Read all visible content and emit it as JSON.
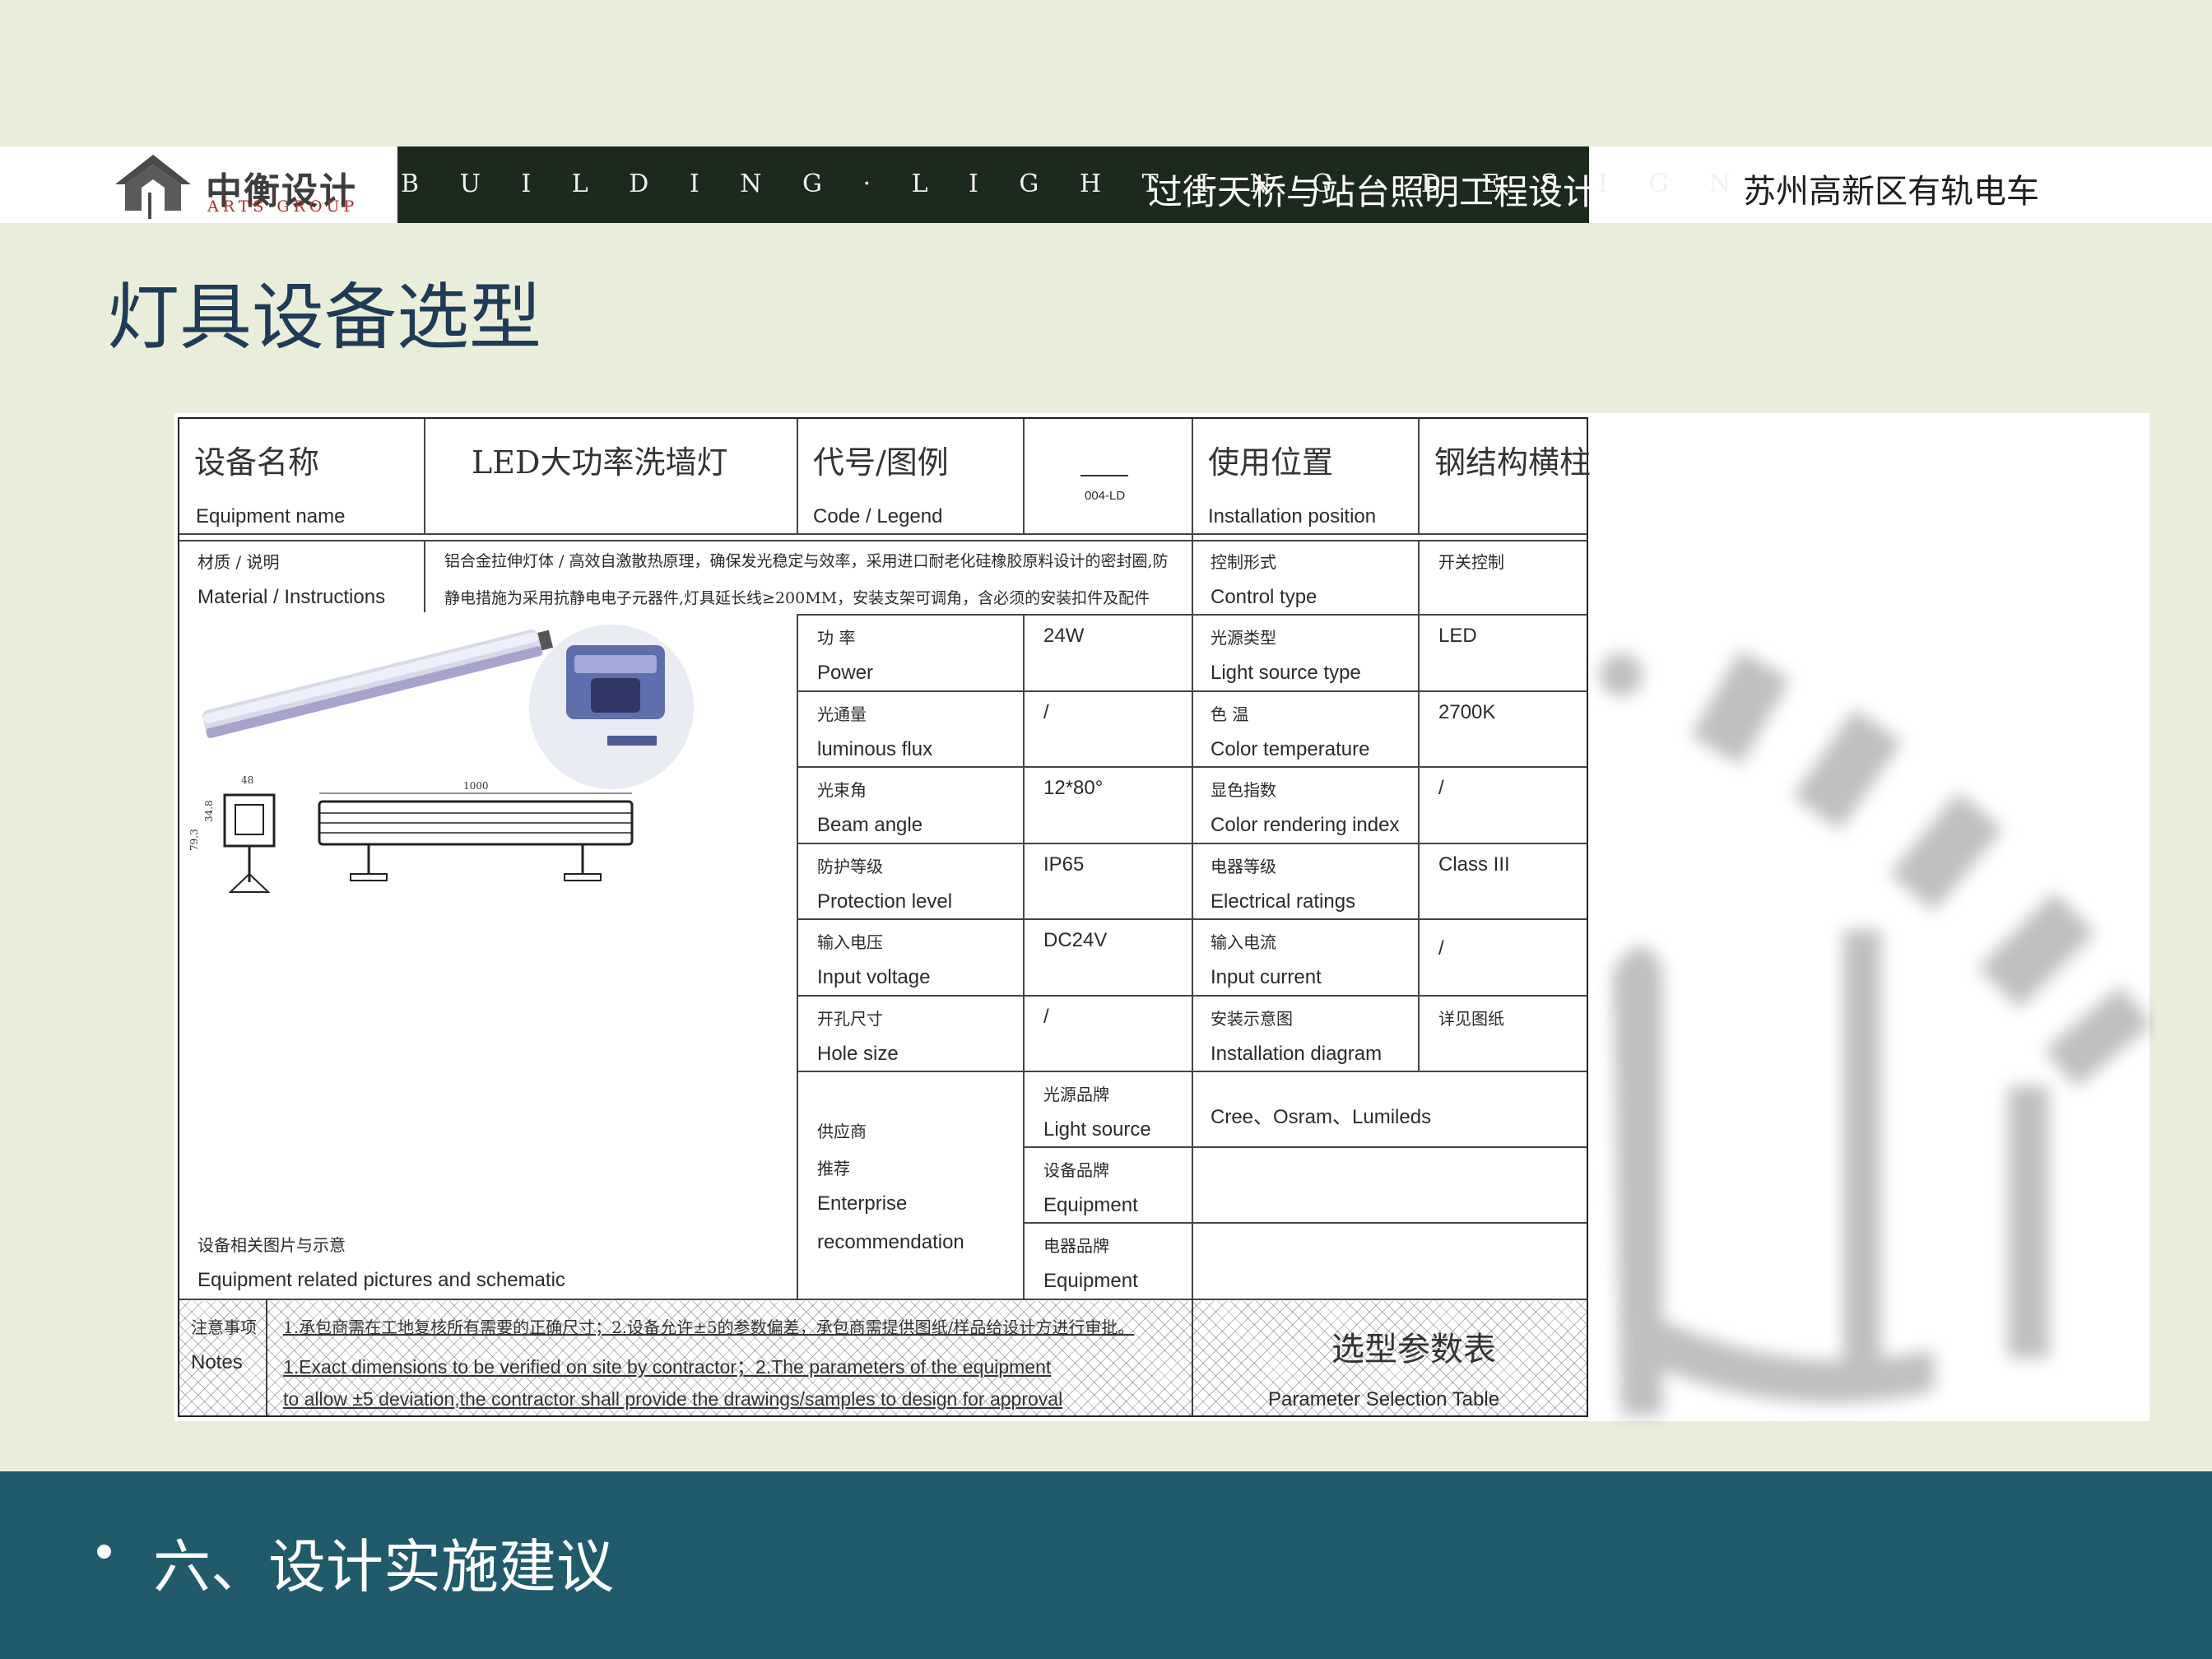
{
  "header": {
    "logo_cn": "中衡设计",
    "logo_en": "ARTS GROUP",
    "banner_en": "B U I L D I N G · L I G H T I N G · D E S I G N",
    "banner_cn": "过街天桥与站台照明工程设计",
    "project": "苏州高新区有轨电车"
  },
  "page_title": "灯具设备选型",
  "spec": {
    "equipment_name_cn": "设备名称",
    "equipment_name_en": "Equipment name",
    "equipment_name_value": "LED大功率洗墙灯",
    "code_cn": "代号/图例",
    "code_en": "Code / Legend",
    "code_value": "004-LD",
    "position_cn": "使用位置",
    "position_en": "Installation position",
    "position_value": "钢结构横柱",
    "material_cn": "材质 / 说明",
    "material_en": "Material / Instructions",
    "material_line1": "铝合金拉伸灯体 / 高效自激散热原理，确保发光稳定与效率，采用进口耐老化硅橡胶原料设计的密封圈,防",
    "material_line2": "静电措施为采用抗静电电子元器件,灯具延长线≥200MM，安装支架可调角，含必须的安装扣件及配件",
    "control_cn": "控制形式",
    "control_en": "Control type",
    "control_value": "开关控制",
    "rows": [
      {
        "l_cn": "功  率",
        "l_en": "Power",
        "l_val": "24W",
        "r_cn": "光源类型",
        "r_en": "Light source type",
        "r_val": "LED"
      },
      {
        "l_cn": "光通量",
        "l_en": "luminous flux",
        "l_val": "/",
        "r_cn": "色  温",
        "r_en": "Color temperature",
        "r_val": "2700K"
      },
      {
        "l_cn": "光束角",
        "l_en": "Beam angle",
        "l_val": "12*80°",
        "r_cn": "显色指数",
        "r_en": "Color rendering index",
        "r_val": "/"
      },
      {
        "l_cn": "防护等级",
        "l_en": "Protection level",
        "l_val": "IP65",
        "r_cn": "电器等级",
        "r_en": "Electrical ratings",
        "r_val": "Class III"
      },
      {
        "l_cn": "输入电压",
        "l_en": "Input voltage",
        "l_val": "DC24V",
        "r_cn": "输入电流",
        "r_en": "Input current",
        "r_val": "/"
      },
      {
        "l_cn": "开孔尺寸",
        "l_en": "Hole size",
        "l_val": "/",
        "r_cn": "安装示意图",
        "r_en": "Installation diagram",
        "r_val": "详见图纸"
      }
    ],
    "supplier_cn1": "供应商",
    "supplier_cn2": "推荐",
    "supplier_en1": "Enterprise",
    "supplier_en2": "recommendation",
    "brands": [
      {
        "cn": "光源品牌",
        "en": "Light source",
        "value": "Cree、Osram、Lumileds"
      },
      {
        "cn": "设备品牌",
        "en": "Equipment",
        "value": ""
      },
      {
        "cn": "电器品牌",
        "en": "Equipment",
        "value": ""
      }
    ],
    "pictures_cn": "设备相关图片与示意",
    "pictures_en": "Equipment related pictures and schematic",
    "dims": {
      "width": "48",
      "length": "1000",
      "h1": "34.8",
      "h2": "79.3"
    },
    "notes_label_cn": "注意事项",
    "notes_label_en": "Notes",
    "notes_cn": "1.承包商需在工地复核所有需要的正确尺寸；2.设备允许±5的参数偏差，承包商需提供图纸/样品给设计方进行审批。",
    "notes_en1": "1.Exact dimensions to be verified on site by contractor；2.The parameters of the equipment",
    "notes_en2": "to allow ±5 deviation,the contractor shall provide the drawings/samples to design for approval",
    "table_name_cn": "选型参数表",
    "table_name_en": "Parameter Selection Table"
  },
  "footer": {
    "text": "六、设计实施建议"
  },
  "colors": {
    "background": "#e9eedb",
    "banner": "#1c2a1d",
    "title": "#1f3b57",
    "footer": "#215a6a"
  }
}
